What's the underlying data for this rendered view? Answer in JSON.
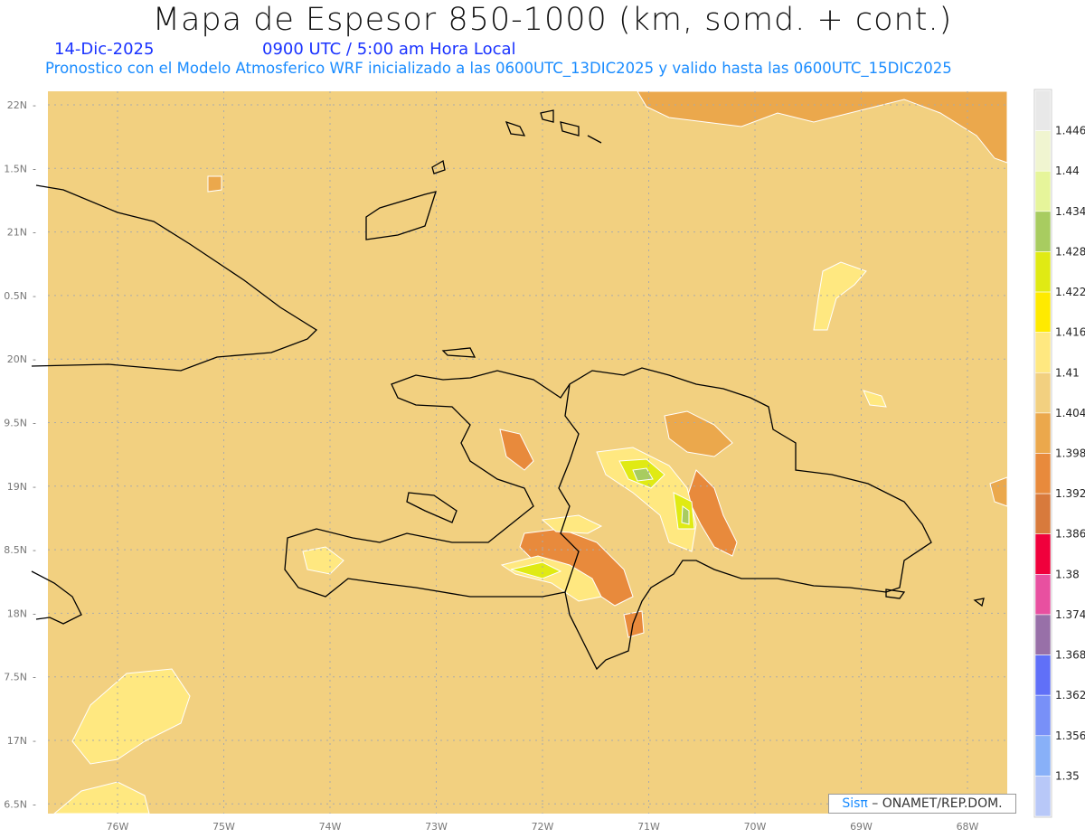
{
  "header": {
    "title": "Mapa de Espesor 850-1000 (km, somd. + cont.)",
    "date": "14-Dic-2025",
    "time": "0900 UTC / 5:00 am Hora Local",
    "description": "Pronostico con el Modelo Atmosferico WRF inicializado a las 0600UTC_13DIC2025 y valido hasta las  0600UTC_15DIC2025"
  },
  "map": {
    "lat_labels": [
      "22N",
      "1.5N",
      "21N",
      "0.5N",
      "20N",
      "9.5N",
      "19N",
      "8.5N",
      "18N",
      "7.5N",
      "17N",
      "6.5N"
    ],
    "lon_labels": [
      "76W",
      "75W",
      "74W",
      "73W",
      "72W",
      "71W",
      "70W",
      "69W",
      "68W"
    ],
    "background_color": "#f2d080"
  },
  "colorbar": {
    "labels": [
      "1.446",
      "1.44",
      "1.434",
      "1.428",
      "1.422",
      "1.416",
      "1.41",
      "1.404",
      "1.398",
      "1.392",
      "1.386",
      "1.38",
      "1.374",
      "1.368",
      "1.362",
      "1.356",
      "1.35"
    ],
    "colors": [
      "#e8e8e8",
      "#f0f5d0",
      "#e6f59a",
      "#a8cc60",
      "#e0ea14",
      "#ffea00",
      "#ffe880",
      "#f2d080",
      "#eba84c",
      "#e88a3c",
      "#d87a3c",
      "#f0003c",
      "#e850a0",
      "#9870a8",
      "#6070f8",
      "#7890f8",
      "#88b0f8",
      "#b8c8f8"
    ]
  },
  "logo": {
    "brand": "Sisπ",
    "text": " –  ONAMET/REP.DOM."
  }
}
